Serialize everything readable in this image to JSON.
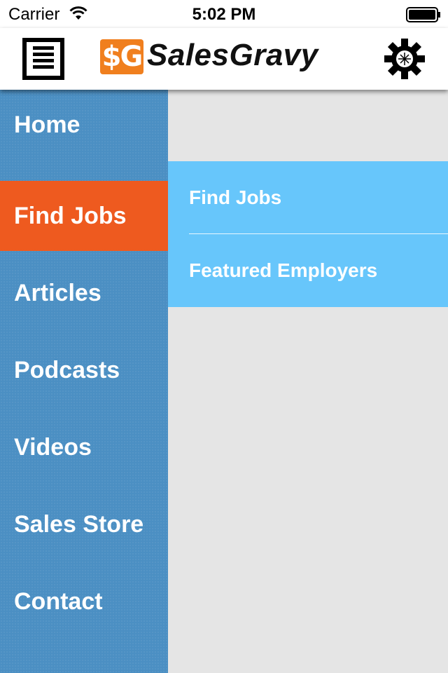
{
  "status_bar": {
    "carrier": "Carrier",
    "time": "5:02 PM",
    "icons": [
      "wifi-icon",
      "battery-icon"
    ]
  },
  "header": {
    "menu_icon": "menu-icon",
    "logo_mark": "$G",
    "logo_text": "SalesGravy",
    "settings_icon": "gear-icon",
    "colors": {
      "logo_mark": "#f07f1e",
      "header_bg": "#ffffff"
    }
  },
  "sidebar": {
    "colors": {
      "background": "#4b8fc3",
      "active": "#ee5a1f",
      "text": "#ffffff"
    },
    "items": [
      {
        "label": "Home"
      },
      {
        "label": "Find Jobs",
        "active": true
      },
      {
        "label": "Articles"
      },
      {
        "label": "Podcasts"
      },
      {
        "label": "Videos"
      },
      {
        "label": "Sales Store"
      },
      {
        "label": "Contact"
      }
    ]
  },
  "submenu": {
    "colors": {
      "background": "#67c6fb",
      "text": "#ffffff"
    },
    "items": [
      {
        "label": "Find Jobs"
      },
      {
        "label": "Featured Employers"
      }
    ]
  }
}
